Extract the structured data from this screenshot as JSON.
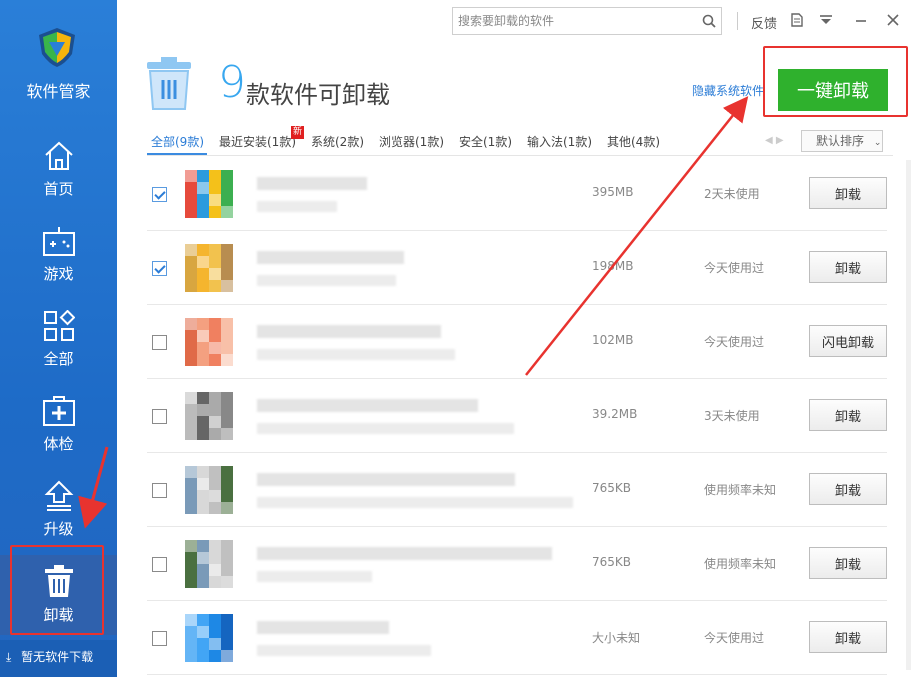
{
  "sidebar": {
    "app_name": "软件管家",
    "items": [
      {
        "label": "首页",
        "icon": "home-icon"
      },
      {
        "label": "游戏",
        "icon": "gamepad-icon"
      },
      {
        "label": "全部",
        "icon": "grid-icon"
      },
      {
        "label": "体检",
        "icon": "medkit-icon"
      },
      {
        "label": "升级",
        "icon": "upload-arrow-icon"
      },
      {
        "label": "卸载",
        "icon": "trash-icon"
      }
    ],
    "download_label": "暂无软件下载"
  },
  "topbar": {
    "search_placeholder": "搜索要卸载的软件",
    "feedback_label": "反馈"
  },
  "header": {
    "count": "9",
    "title": "款软件可卸载",
    "hide_system_label": "隐藏系统软件",
    "one_key_label": "一键卸载"
  },
  "tabs": [
    {
      "label": "全部(9款)"
    },
    {
      "label": "最近安装(1款)"
    },
    {
      "label": "系统(2款)"
    },
    {
      "label": "浏览器(1款)"
    },
    {
      "label": "安全(1款)"
    },
    {
      "label": "输入法(1款)"
    },
    {
      "label": "其他(4款)"
    }
  ],
  "new_badge": "新",
  "sort_label": "默认排序",
  "rows": [
    {
      "checked": true,
      "size": "395MB",
      "usage": "2天未使用",
      "action": "卸载",
      "colors": [
        "#e64a3c",
        "#3caf50",
        "#f4c11a",
        "#2b9bde"
      ]
    },
    {
      "checked": true,
      "size": "198MB",
      "usage": "今天使用过",
      "action": "卸载",
      "colors": [
        "#f5b52e",
        "#d8a640",
        "#b88d50",
        "#f2c24e"
      ]
    },
    {
      "checked": false,
      "size": "102MB",
      "usage": "今天使用过",
      "action": "闪电卸载",
      "colors": [
        "#f08060",
        "#f4a080",
        "#e06a48",
        "#f8c0a8"
      ]
    },
    {
      "checked": false,
      "size": "39.2MB",
      "usage": "3天未使用",
      "action": "卸载",
      "colors": [
        "#888888",
        "#aaaaaa",
        "#666666",
        "#bbbbbb"
      ]
    },
    {
      "checked": false,
      "size": "765KB",
      "usage": "使用频率未知",
      "action": "卸载",
      "colors": [
        "#7a9ab8",
        "#4a7040",
        "#c0c0c0",
        "#d8d8d8"
      ]
    },
    {
      "checked": false,
      "size": "765KB",
      "usage": "使用频率未知",
      "action": "卸载",
      "colors": [
        "#7a9ab8",
        "#4a7040",
        "#c0c0c0",
        "#d8d8d8"
      ]
    },
    {
      "checked": false,
      "size": "大小未知",
      "usage": "今天使用过",
      "action": "卸载",
      "colors": [
        "#1e88e5",
        "#42a5f5",
        "#64b5f6",
        "#1565c0"
      ]
    }
  ],
  "colors": {
    "accent_green": "#2fb12d",
    "accent_blue": "#2b7cd6",
    "annotation_red": "#e8332f"
  }
}
